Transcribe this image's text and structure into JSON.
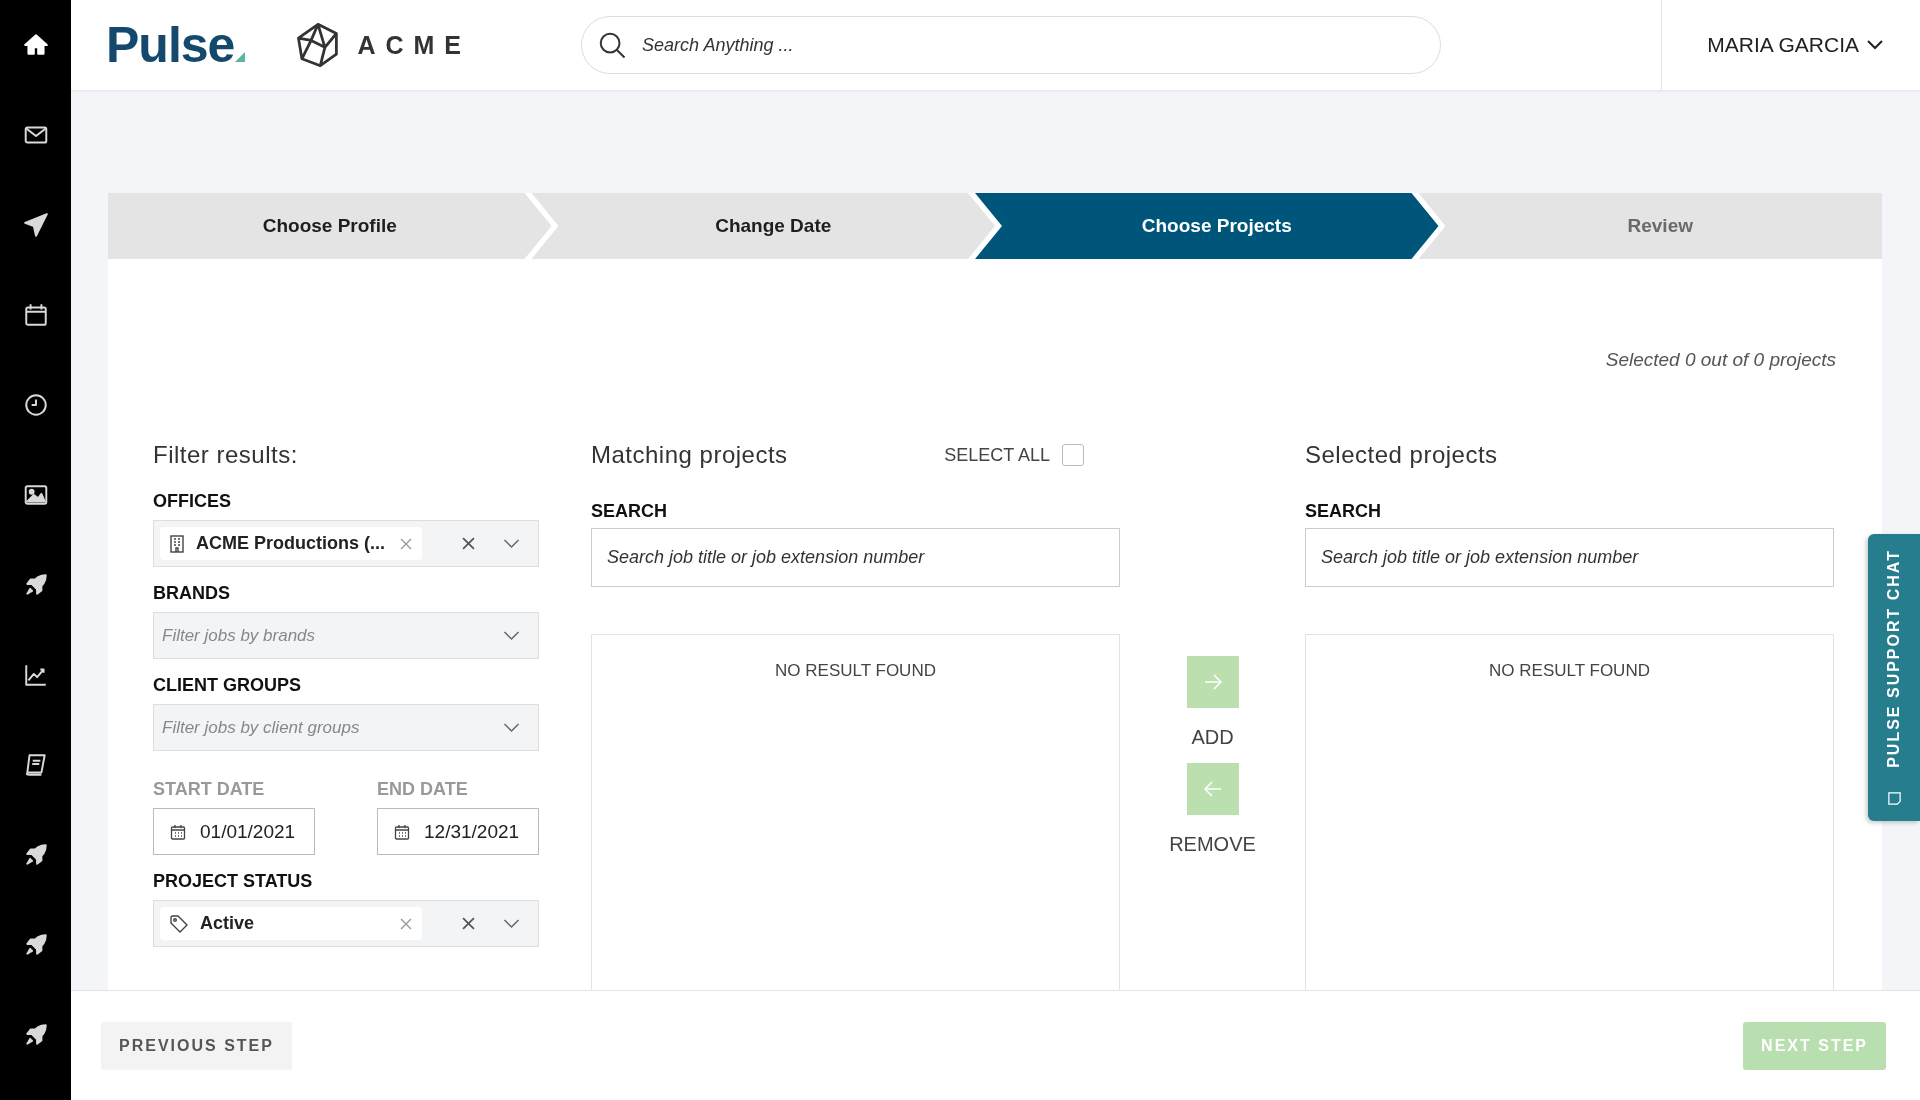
{
  "sidebar": {
    "items": [
      {
        "kind": "home",
        "selected": true
      },
      {
        "kind": "mail",
        "selected": false
      },
      {
        "kind": "send",
        "selected": false
      },
      {
        "kind": "calendar",
        "selected": false
      },
      {
        "kind": "clock",
        "selected": false
      },
      {
        "kind": "image",
        "selected": false
      },
      {
        "kind": "rocket",
        "selected": false
      },
      {
        "kind": "chart",
        "selected": false
      },
      {
        "kind": "book",
        "selected": false
      },
      {
        "kind": "rocket",
        "selected": false
      },
      {
        "kind": "rocket",
        "selected": false
      },
      {
        "kind": "rocket",
        "selected": false
      }
    ]
  },
  "header": {
    "logo": "Pulse",
    "brand": "ACME",
    "search_placeholder": "Search Anything ...",
    "user": "MARIA GARCIA"
  },
  "steps": [
    {
      "label": "Choose Profile",
      "selected": false,
      "disabled": false
    },
    {
      "label": "Change Date",
      "selected": false,
      "disabled": false
    },
    {
      "label": "Choose Projects",
      "selected": true,
      "disabled": false
    },
    {
      "label": "Review",
      "selected": false,
      "disabled": true
    }
  ],
  "summary": "Selected 0 out of 0 projects",
  "filters": {
    "title": "Filter results:",
    "offices": {
      "label": "OFFICES",
      "tag": "ACME Productions (..."
    },
    "brands": {
      "label": "BRANDS",
      "placeholder": "Filter jobs by brands"
    },
    "client_groups": {
      "label": "CLIENT GROUPS",
      "placeholder": "Filter jobs by client groups"
    },
    "start_date": {
      "label": "START DATE",
      "value": "01/01/2021"
    },
    "end_date": {
      "label": "END DATE",
      "value": "12/31/2021"
    },
    "project_status": {
      "label": "PROJECT STATUS",
      "tag": "Active"
    }
  },
  "matching": {
    "title": "Matching projects",
    "select_all": {
      "label": "SELECT ALL",
      "checked": false
    },
    "search_label": "SEARCH",
    "search_placeholder": "Search job title or job extension number",
    "empty": "NO RESULT FOUND"
  },
  "transfer": {
    "add": {
      "label": "ADD",
      "disabled": true
    },
    "remove": {
      "label": "REMOVE",
      "disabled": true
    }
  },
  "selected": {
    "title": "Selected projects",
    "search_label": "SEARCH",
    "search_placeholder": "Search job title or job extension number",
    "empty": "NO RESULT FOUND"
  },
  "chat": {
    "label": "PULSE SUPPORT CHAT"
  },
  "footer": {
    "previous": {
      "label": "PREVIOUS STEP",
      "disabled": false
    },
    "next": {
      "label": "NEXT STEP",
      "disabled": true
    }
  }
}
